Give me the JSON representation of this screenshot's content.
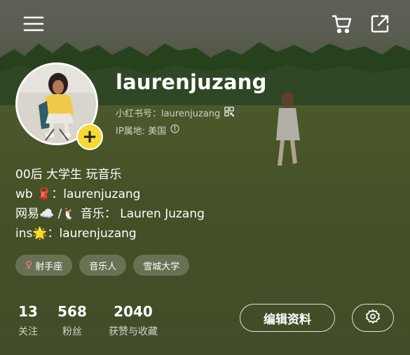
{
  "profile": {
    "username": "laurenjuzang",
    "id_label": "小红书号：laurenjuzang",
    "ip_label": "IP属地: 美国"
  },
  "bio": {
    "line1": "00后 大学生 玩音乐",
    "line2": "wb 🧣：laurenjuzang",
    "line3": "网易☁️ /🐧 音乐： Lauren Juzang",
    "line4": "ins🌟：laurenjuzang"
  },
  "tags": [
    {
      "label": "射手座",
      "icon": "female-symbol-icon"
    },
    {
      "label": "音乐人"
    },
    {
      "label": "雪城大学"
    }
  ],
  "stats": {
    "following": {
      "value": "13",
      "label": "关注"
    },
    "fans": {
      "value": "568",
      "label": "粉丝"
    },
    "likes": {
      "value": "2040",
      "label": "获赞与收藏"
    }
  },
  "actions": {
    "edit_label": "编辑资料"
  },
  "colors": {
    "add_button": "#f5d935",
    "venus_symbol": "#ff7a8a"
  }
}
